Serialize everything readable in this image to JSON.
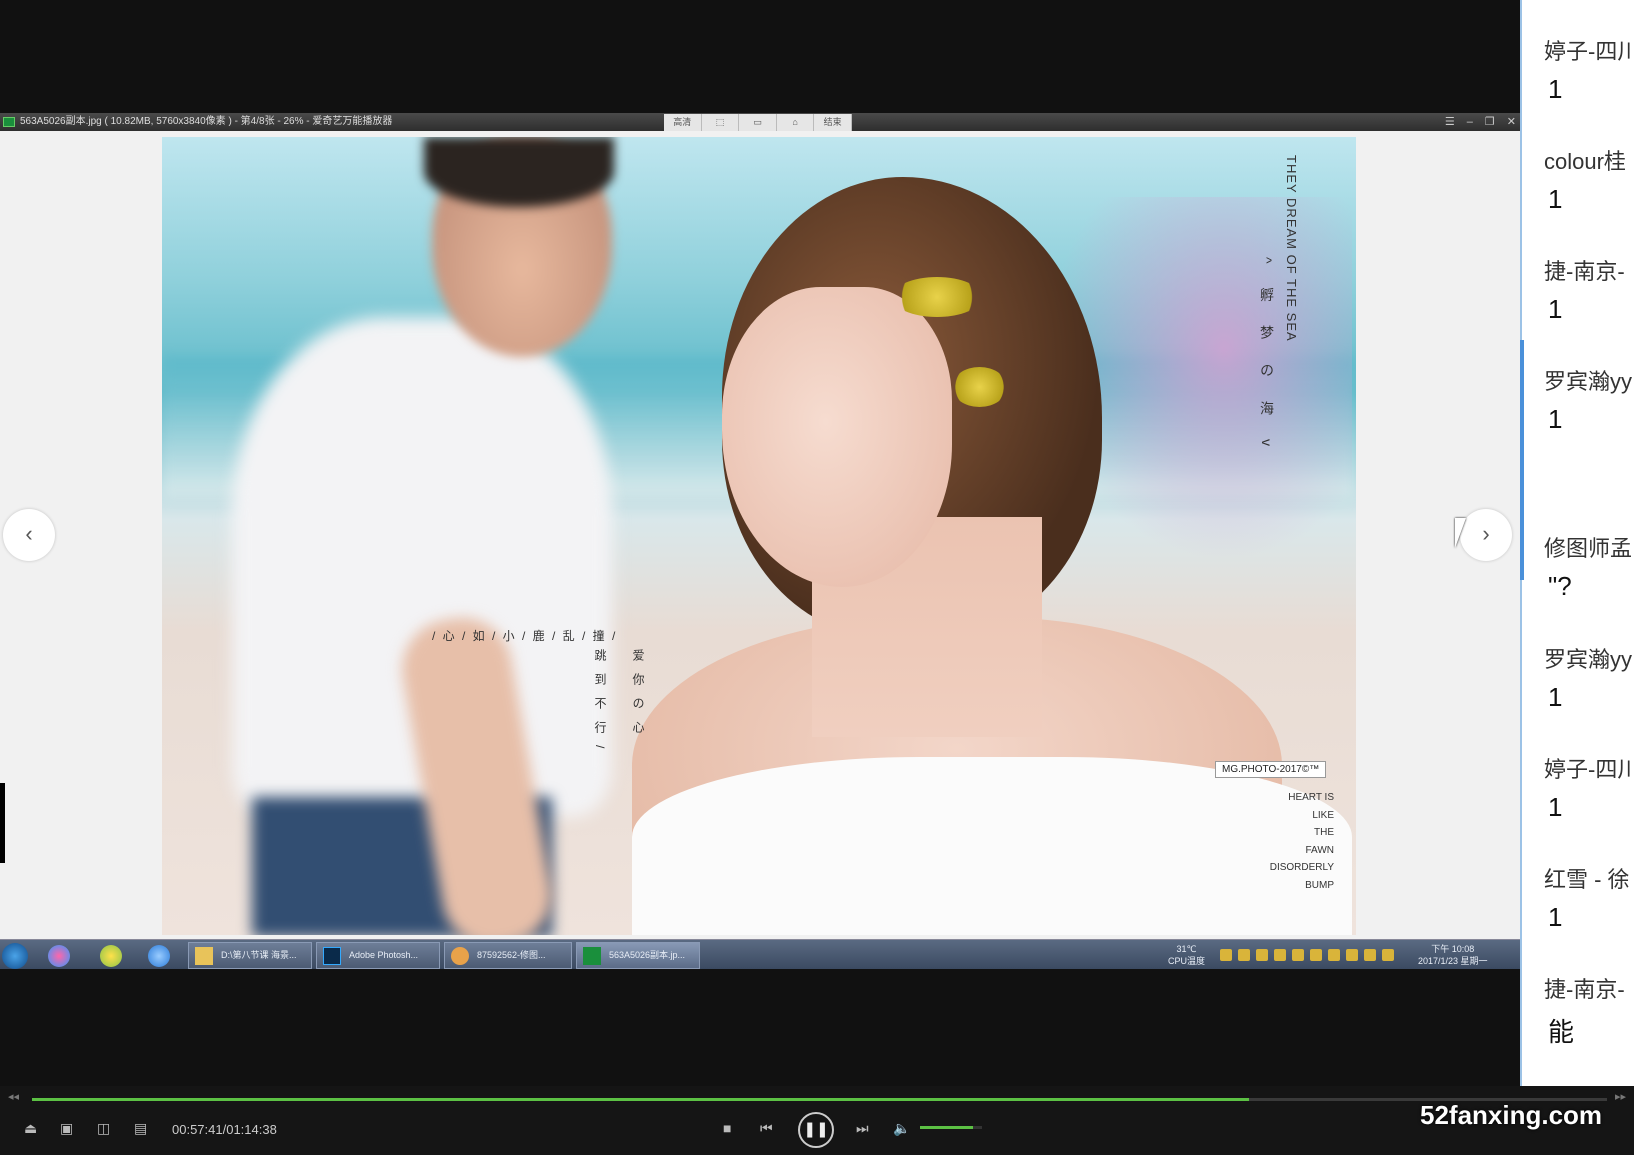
{
  "viewer": {
    "title": "563A5026副本.jpg ( 10.82MB, 5760x3840像素 ) - 第4/8张 - 26% - 爱奇艺万能播放器",
    "tools": [
      "高清",
      "",
      "",
      "",
      "结束"
    ],
    "window_controls": [
      "☰",
      "–",
      "❐",
      "✕"
    ],
    "prev_arrow": "‹",
    "next_arrow": "›"
  },
  "photo": {
    "vertical_en": "THEY DREAM OF THE SEA",
    "vertical_cn": "^ 孵 梦 の 海 v",
    "poem_row": "/ 心 / 如 / 小 / 鹿 / 乱 / 撞 /",
    "poem_col1": "跳到不行/",
    "poem_col2": "爱你の心",
    "badge": "MG.PHOTO-2017©™",
    "en_lines": [
      "HEART IS",
      "LIKE",
      "THE",
      "FAWN",
      "DISORDERLY",
      "BUMP"
    ]
  },
  "taskbar": {
    "tasks": [
      "D:\\第八节课 海景...",
      "Adobe Photosh...",
      "87592562-修图...",
      "563A5026副本.jp..."
    ],
    "temp": "31℃",
    "temp_label": "CPU温度",
    "clock_time": "下午 10:08",
    "clock_date": "2017/1/23 星期一"
  },
  "chat": {
    "messages": [
      {
        "name": "婷子-四川",
        "text": "1"
      },
      {
        "name": "colour桂",
        "text": "1"
      },
      {
        "name": "捷-南京-",
        "text": "1"
      },
      {
        "name": "罗宾瀚yy",
        "text": "1"
      },
      {
        "name": "修图师孟",
        "text": "\"?"
      },
      {
        "name": "罗宾瀚yy",
        "text": "1"
      },
      {
        "name": "婷子-四川",
        "text": "1"
      },
      {
        "name": "红雪 -  徐",
        "text": "1"
      },
      {
        "name": "捷-南京-",
        "text": "能"
      }
    ]
  },
  "player": {
    "time": "00:57:41/01:14:38",
    "progress": 0.773,
    "volume": 0.85,
    "skip_back": "◂◂",
    "skip_fwd": "▸▸",
    "stop": "■",
    "prev": "⏮",
    "pause": "❚❚",
    "next": "⏭",
    "volume_icon": "🔈"
  },
  "watermark": "52fanxing.com",
  "colors": {
    "accent": "#5cc144",
    "chat_border": "#4a90d9"
  }
}
